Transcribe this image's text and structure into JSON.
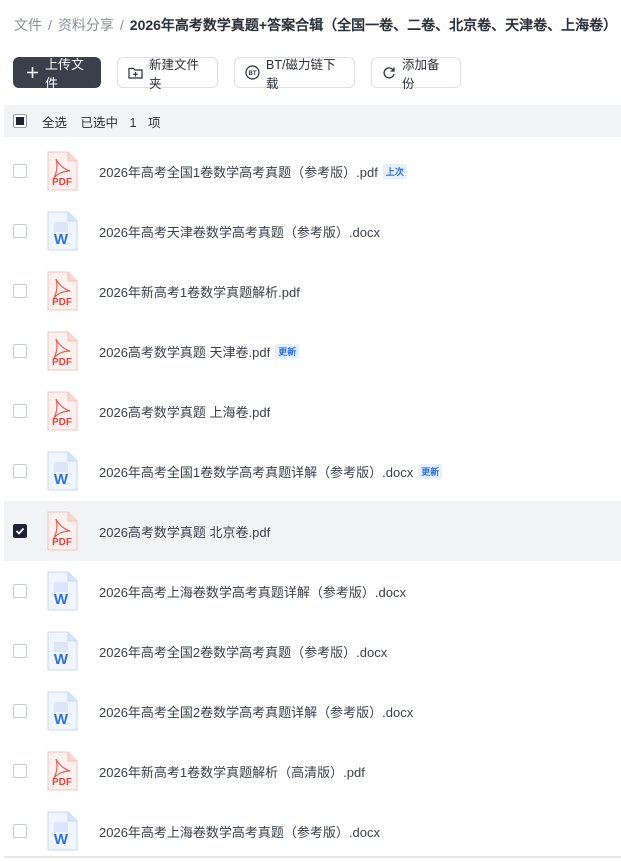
{
  "breadcrumb": {
    "items": [
      "文件",
      "资料分享",
      "2026年高考数学真题+答案合辑（全国一卷、二卷、北京卷、天津卷、上海卷）"
    ],
    "separator": "/"
  },
  "toolbar": {
    "upload_label": "上传文件",
    "new_folder_label": "新建文件夹",
    "bt_label": "BT/磁力链下载",
    "backup_label": "添加备份"
  },
  "list_header": {
    "select_all_label": "全选",
    "selected_prefix": "已选中",
    "selected_count": "1",
    "selected_suffix": "项"
  },
  "files": [
    {
      "name": "2026年高考全国1卷数学高考真题（参考版）.pdf",
      "type": "pdf",
      "tag": "上次",
      "selected": false
    },
    {
      "name": "2026年高考天津卷数学高考真题（参考版）.docx",
      "type": "word",
      "tag": "",
      "selected": false
    },
    {
      "name": "2026年新高考1卷数学真题解析.pdf",
      "type": "pdf",
      "tag": "",
      "selected": false
    },
    {
      "name": "2026高考数学真题 天津卷.pdf",
      "type": "pdf",
      "tag": "更新",
      "selected": false
    },
    {
      "name": "2026高考数学真题 上海卷.pdf",
      "type": "pdf",
      "tag": "",
      "selected": false
    },
    {
      "name": "2026年高考全国1卷数学高考真题详解（参考版）.docx",
      "type": "word",
      "tag": "更新",
      "selected": false
    },
    {
      "name": "2026高考数学真题 北京卷.pdf",
      "type": "pdf",
      "tag": "",
      "selected": true
    },
    {
      "name": "2026年高考上海卷数学高考真题详解（参考版）.docx",
      "type": "word",
      "tag": "",
      "selected": false
    },
    {
      "name": "2026年高考全国2卷数学高考真题（参考版）.docx",
      "type": "word",
      "tag": "",
      "selected": false
    },
    {
      "name": "2026年高考全国2卷数学高考真题详解（参考版）.docx",
      "type": "word",
      "tag": "",
      "selected": false
    },
    {
      "name": "2026年新高考1卷数学真题解析（高清版）.pdf",
      "type": "pdf",
      "tag": "",
      "selected": false
    },
    {
      "name": "2026年高考上海卷数学高考真题（参考版）.docx",
      "type": "word",
      "tag": "",
      "selected": false
    }
  ],
  "icons": {
    "pdf_label": "PDF",
    "word_label": "W",
    "bt_badge": "BT"
  },
  "colors": {
    "pdf_red": "#e0463a",
    "word_blue": "#2f6fe0",
    "primary_button": "#3b3f4c",
    "tag_blue": "#2f6fe0"
  }
}
